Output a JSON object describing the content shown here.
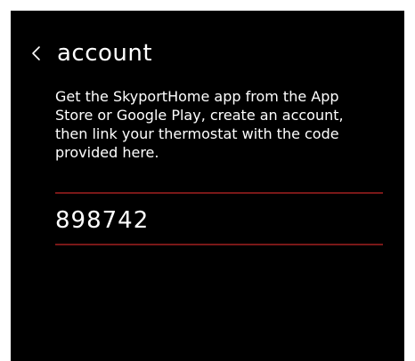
{
  "header": {
    "title": "account",
    "back_icon": "chevron-left-icon"
  },
  "main": {
    "instructions": "Get the SkyportHome app from the App Store or Google Play, create an account, then link your thermostat with the code provided here.",
    "link_code": "898742"
  },
  "colors": {
    "background": "#000000",
    "text": "#ffffff",
    "divider": "#7a1818"
  }
}
